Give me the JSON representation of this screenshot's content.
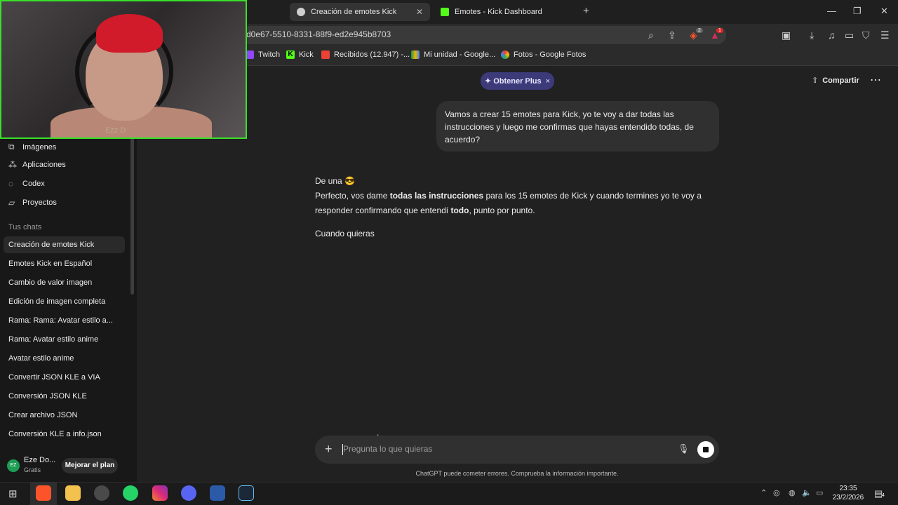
{
  "browser": {
    "tabs": [
      {
        "title": "Creación de emotes Kick",
        "active": true
      },
      {
        "title": "Emotes - Kick Dashboard",
        "active": false
      }
    ],
    "new_tab": "+",
    "window_controls": {
      "minimize": "—",
      "maximize": "❐",
      "close": "✕"
    },
    "url": "d0e67-5510-8331-88f9-ed2e945b8703",
    "bookmarks": [
      "Twitch",
      "Kick",
      "Recibidos (12.947) -...",
      "Mi unidad - Google...",
      "Fotos - Google Fotos"
    ],
    "badges": {
      "shields": "2",
      "rewards": "1"
    }
  },
  "sidebar": {
    "nav": [
      {
        "label": "Imágenes",
        "icon": "images-icon"
      },
      {
        "label": "Aplicaciones",
        "icon": "apps-icon"
      },
      {
        "label": "Codex",
        "icon": "codex-icon"
      },
      {
        "label": "Proyectos",
        "icon": "folder-icon"
      }
    ],
    "section_label": "Tus chats",
    "chats": [
      "Creación de emotes Kick",
      "Emotes Kick en Español",
      "Cambio de valor imagen",
      "Edición de imagen completa",
      "Rama: Rama: Avatar estilo a...",
      "Rama: Avatar estilo anime",
      "Avatar estilo anime",
      "Convertir JSON KLE a VIA",
      "Conversión JSON KLE",
      "Crear archivo JSON",
      "Conversión KLE a info.json"
    ],
    "user": {
      "initials": "EZ",
      "name": "Eze Do...",
      "plan": "Gratis",
      "upgrade": "Mejorar el plan"
    }
  },
  "header": {
    "plus_pill": "Obtener Plus",
    "plus_close": "×",
    "share": "Compartir",
    "more": "⋯"
  },
  "conversation": {
    "user_message": "Vamos a crear 15 emotes para Kick, yo te voy a dar todas las instrucciones y luego me confirmas que hayas entendido todas, de acuerdo?",
    "assistant": {
      "line1": "De una 😎",
      "p2_a": "Perfecto, vos dame ",
      "p2_b": "todas las instrucciones",
      "p2_c": " para los 15 emotes de Kick y cuando termines yo te voy a responder confirmando que entendí ",
      "p2_d": "todo",
      "p2_e": ", punto por punto.",
      "line3": "Cuando quieras"
    }
  },
  "composer": {
    "placeholder": "Pregunta lo que quieras",
    "disclaimer": "ChatGPT puede cometer errores. Comprueba la información importante."
  },
  "webcam": {
    "overlay_text": "Ezz D"
  },
  "taskbar": {
    "time": "23:35",
    "date": "23/2/2026",
    "notifications": "4"
  }
}
